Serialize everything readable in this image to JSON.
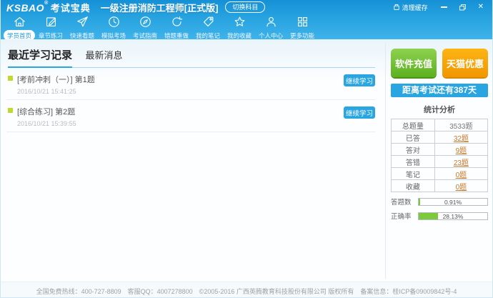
{
  "window": {
    "logo": "KSBAO",
    "logo_reg": "®",
    "app_name": "考试宝典",
    "title": "一级注册消防工程师[正式版]",
    "switch_subject": "切换科目",
    "clear_cache": "清理缓存",
    "close_glyph": "✕"
  },
  "nav": {
    "items": [
      {
        "label": "学员首页",
        "icon": "home-icon",
        "active": true
      },
      {
        "label": "章节练习",
        "icon": "edit-icon",
        "active": false
      },
      {
        "label": "快速看题",
        "icon": "paper-plane-icon",
        "active": false
      },
      {
        "label": "模拟考场",
        "icon": "clock-icon",
        "active": false
      },
      {
        "label": "考试指南",
        "icon": "compass-icon",
        "active": false
      },
      {
        "label": "错题重做",
        "icon": "redo-icon",
        "active": false
      },
      {
        "label": "我的笔记",
        "icon": "tag-icon",
        "active": false
      },
      {
        "label": "我的收藏",
        "icon": "star-icon",
        "active": false
      },
      {
        "label": "个人中心",
        "icon": "user-icon",
        "active": false
      },
      {
        "label": "更多功能",
        "icon": "grid-icon",
        "active": false
      }
    ]
  },
  "main": {
    "tabs": [
      {
        "label": "最近学习记录",
        "active": true
      },
      {
        "label": "最新消息",
        "active": false
      }
    ],
    "records": [
      {
        "title": "[考前冲刺（一）] 第1题",
        "time": "2016/10/21 15:41:25",
        "action": "继续学习"
      },
      {
        "title": "[综合练习] 第2题",
        "time": "2016/10/21 15:39:55",
        "action": "继续学习"
      }
    ]
  },
  "sidebar": {
    "recharge_label": "软件充值",
    "tmall_label": "天猫优惠",
    "countdown": "距离考试还有387天",
    "stats_title": "统计分析",
    "stats": [
      {
        "label": "总题量",
        "value": "3533题"
      },
      {
        "label": "已答",
        "value": "32题"
      },
      {
        "label": "答对",
        "value": "9题"
      },
      {
        "label": "答错",
        "value": "23题"
      },
      {
        "label": "笔记",
        "value": "0题"
      },
      {
        "label": "收藏",
        "value": "0题"
      }
    ],
    "progress": [
      {
        "label": "答题数",
        "percent": "0.91%",
        "value": 0.91
      },
      {
        "label": "正确率",
        "percent": "28.13%",
        "value": 28.13
      }
    ]
  },
  "footer": {
    "text": "全国免费热线：400-727-8809　客服QQ：4007278800　©2005-2016 广西英腾教育科技股份有限公司 版权所有　备案信息：桂ICP备09009842号-4"
  },
  "colors": {
    "accent": "#29a5e2",
    "green_button": "#6cbf2e",
    "orange_button": "#f7a300",
    "stat_link": "#c8792a",
    "bullet": "#c3d82f",
    "progress_fill": "#7cc93d"
  }
}
